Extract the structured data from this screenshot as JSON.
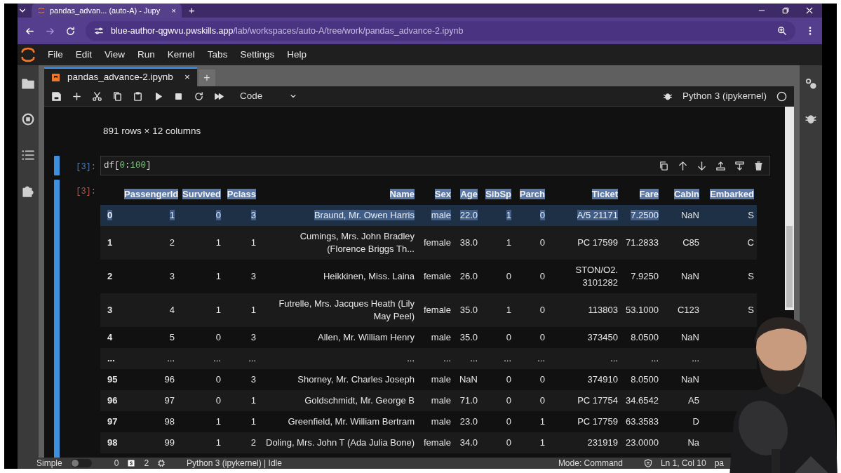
{
  "browser": {
    "tab_title": "pandas_advan... (auto-A) - Jupy",
    "tab_close": "×",
    "new_tab": "+",
    "url_host": "blue-author-qgwvu.pwskills.app",
    "url_path": "/lab/workspaces/auto-A/tree/work/pandas_advance-2.ipynb"
  },
  "menu": [
    "File",
    "Edit",
    "View",
    "Run",
    "Kernel",
    "Tabs",
    "Settings",
    "Help"
  ],
  "doc_tabs": [
    {
      "label": "pandas_advance-2.ipynb",
      "close": "×",
      "selected": true
    }
  ],
  "new_doc_tab": "+",
  "toolbar": {
    "cell_type": "Code",
    "kernel": "Python 3 (ipykernel)"
  },
  "previous_output": "891 rows × 12 columns",
  "cell": {
    "prompt_in": "[3]:",
    "prompt_out": "[3]:",
    "code": [
      {
        "text": "df[",
        "kind": "plain"
      },
      {
        "text": "0",
        "kind": "number"
      },
      {
        "text": ":",
        "kind": "plain"
      },
      {
        "text": "100",
        "kind": "number"
      },
      {
        "text": "]",
        "kind": "plain"
      }
    ]
  },
  "table": {
    "columns": [
      {
        "kind": "index",
        "selected": false
      },
      {
        "label": "PassengerId",
        "selected": true
      },
      {
        "label": "Survived",
        "selected": true
      },
      {
        "label": "Pclass",
        "selected": true
      },
      {
        "label": "Name",
        "selected": true
      },
      {
        "label": "Sex",
        "selected": true
      },
      {
        "label": "Age",
        "selected": true
      },
      {
        "label": "SibSp",
        "selected": true
      },
      {
        "label": "Parch",
        "selected": true
      },
      {
        "label": "Ticket",
        "selected": true
      },
      {
        "label": "Fare",
        "selected": true
      },
      {
        "label": "Cabin",
        "selected": true
      },
      {
        "label": "Embarked",
        "selected": true
      }
    ],
    "rows": [
      {
        "cells": [
          "0",
          "1",
          "0",
          "3",
          "Braund, Mr. Owen Harris",
          "male",
          "22.0",
          "1",
          "0",
          "A/5 21171",
          "7.2500",
          "NaN",
          "S"
        ],
        "selected": true,
        "marked": [
          true,
          true,
          true,
          true,
          true,
          true,
          true,
          true,
          true,
          true,
          true,
          false,
          false
        ]
      },
      {
        "cells": [
          "1",
          "2",
          "1",
          "1",
          "Cumings, Mrs. John Bradley (Florence Briggs Th...",
          "female",
          "38.0",
          "1",
          "0",
          "PC 17599",
          "71.2833",
          "C85",
          "C"
        ],
        "selected": false
      },
      {
        "cells": [
          "2",
          "3",
          "1",
          "3",
          "Heikkinen, Miss. Laina",
          "female",
          "26.0",
          "0",
          "0",
          "STON/O2. 3101282",
          "7.9250",
          "NaN",
          "S"
        ],
        "selected": false
      },
      {
        "cells": [
          "3",
          "4",
          "1",
          "1",
          "Futrelle, Mrs. Jacques Heath (Lily May Peel)",
          "female",
          "35.0",
          "1",
          "0",
          "113803",
          "53.1000",
          "C123",
          "S"
        ],
        "selected": false
      },
      {
        "cells": [
          "4",
          "5",
          "0",
          "3",
          "Allen, Mr. William Henry",
          "male",
          "35.0",
          "0",
          "0",
          "373450",
          "8.0500",
          "NaN",
          null
        ],
        "selected": false
      },
      {
        "cells": [
          "...",
          "...",
          "...",
          "...",
          "...",
          "...",
          "...",
          "...",
          "...",
          "...",
          "...",
          "...",
          null
        ],
        "selected": false
      },
      {
        "cells": [
          "95",
          "96",
          "0",
          "3",
          "Shorney, Mr. Charles Joseph",
          "male",
          "NaN",
          "0",
          "0",
          "374910",
          "8.0500",
          "NaN",
          null
        ],
        "selected": false
      },
      {
        "cells": [
          "96",
          "97",
          "0",
          "1",
          "Goldschmidt, Mr. George B",
          "male",
          "71.0",
          "0",
          "0",
          "PC 17754",
          "34.6542",
          "A5",
          null
        ],
        "selected": false
      },
      {
        "cells": [
          "97",
          "98",
          "1",
          "1",
          "Greenfield, Mr. William Bertram",
          "male",
          "23.0",
          "0",
          "1",
          "PC 17759",
          "63.3583",
          "D",
          null
        ],
        "selected": false
      },
      {
        "cells": [
          "98",
          "99",
          "1",
          "2",
          "Doling, Mrs. John T (Ada Julia Bone)",
          "female",
          "34.0",
          "0",
          "1",
          "231919",
          "23.0000",
          "Na",
          null
        ],
        "selected": false
      }
    ]
  },
  "status_bar": {
    "mode_toggle": {
      "label": "Simple",
      "on": false
    },
    "terminals": "0",
    "kernels": "2",
    "kernel_status": "Python 3 (ipykernel) | Idle",
    "mode": "Mode: Command",
    "position": "Ln 1, Col 10",
    "file": "pa"
  }
}
